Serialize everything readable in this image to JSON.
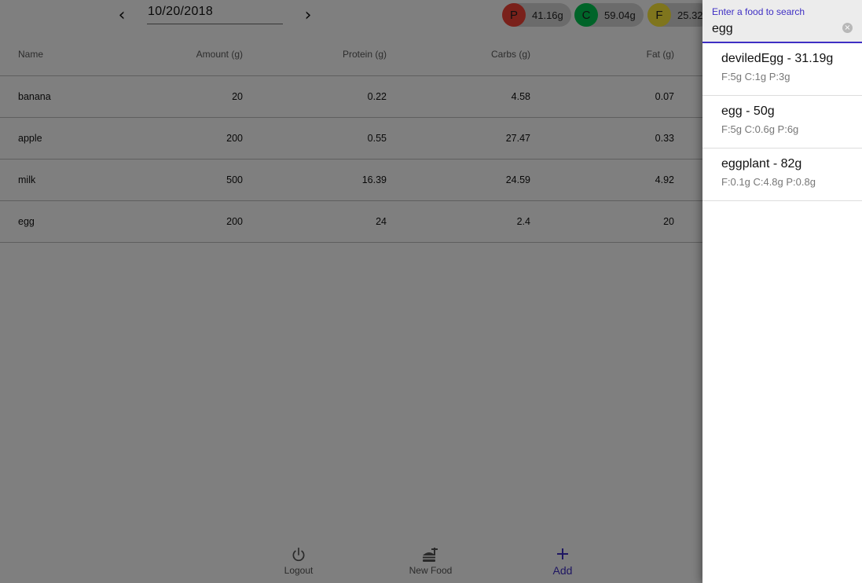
{
  "header": {
    "date": "10/20/2018",
    "prev_icon": "chevron-left-icon",
    "next_icon": "chevron-right-icon",
    "prev_glyph": "‹",
    "next_glyph": "›",
    "macros": [
      {
        "letter": "P",
        "amount": "41.16g",
        "color": "#f44336"
      },
      {
        "letter": "C",
        "amount": "59.04g",
        "color": "#00c853"
      },
      {
        "letter": "F",
        "amount": "25.32",
        "color": "#ffeb3b"
      }
    ]
  },
  "table": {
    "headers": {
      "name": "Name",
      "amount": "Amount (g)",
      "protein": "Protein (g)",
      "carbs": "Carbs (g)",
      "fat": "Fat (g)"
    },
    "rows": [
      {
        "name": "banana",
        "amount": "20",
        "protein": "0.22",
        "carbs": "4.58",
        "fat": "0.07"
      },
      {
        "name": "apple",
        "amount": "200",
        "protein": "0.55",
        "carbs": "27.47",
        "fat": "0.33"
      },
      {
        "name": "milk",
        "amount": "500",
        "protein": "16.39",
        "carbs": "24.59",
        "fat": "4.92"
      },
      {
        "name": "egg",
        "amount": "200",
        "protein": "24",
        "carbs": "2.4",
        "fat": "20"
      }
    ]
  },
  "bottom_nav": {
    "logout": {
      "label": "Logout",
      "icon": "power-icon"
    },
    "new_food": {
      "label": "New Food",
      "icon": "fastfood-icon"
    },
    "add": {
      "label": "Add",
      "icon": "plus-icon",
      "glyph": "+"
    }
  },
  "search": {
    "label": "Enter a food to search",
    "value": "egg",
    "clear_glyph": "×",
    "results": [
      {
        "title": "deviledEgg - 31.19g",
        "macros": "F:5g C:1g P:3g"
      },
      {
        "title": "egg - 50g",
        "macros": "F:5g C:0.6g P:6g"
      },
      {
        "title": "eggplant - 82g",
        "macros": "F:0.1g C:4.8g P:0.8g"
      }
    ]
  },
  "colors": {
    "accent": "#3f2fc4",
    "scrim": "rgba(0,0,0,0.5)"
  }
}
